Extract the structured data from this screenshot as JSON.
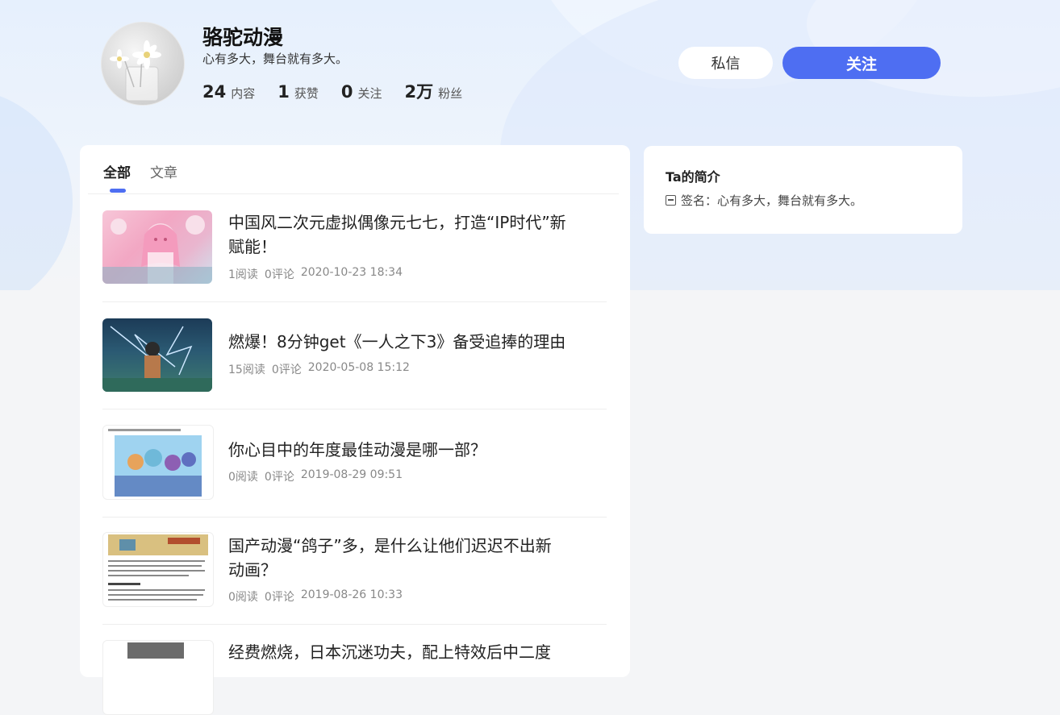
{
  "profile": {
    "name": "骆驼动漫",
    "bio": "心有多大，舞台就有多大。",
    "stats": [
      {
        "num": "24",
        "label": "内容"
      },
      {
        "num": "1",
        "label": "获赞"
      },
      {
        "num": "0",
        "label": "关注"
      },
      {
        "num": "2万",
        "label": "粉丝"
      }
    ]
  },
  "actions": {
    "message": "私信",
    "follow": "关注"
  },
  "tabs": [
    {
      "label": "全部"
    },
    {
      "label": "文章"
    }
  ],
  "articles": [
    {
      "title": "中国风二次元虚拟偶像元七七，打造“IP时代”新赋能！",
      "reads": "1阅读",
      "comments": "0评论",
      "time": "2020-10-23 18:34"
    },
    {
      "title": "燃爆！8分钟get《一人之下3》备受追捧的理由",
      "reads": "15阅读",
      "comments": "0评论",
      "time": "2020-05-08 15:12"
    },
    {
      "title": "你心目中的年度最佳动漫是哪一部？",
      "reads": "0阅读",
      "comments": "0评论",
      "time": "2019-08-29 09:51"
    },
    {
      "title": "国产动漫“鸽子”多，是什么让他们迟迟不出新动画？",
      "reads": "0阅读",
      "comments": "0评论",
      "time": "2019-08-26 10:33"
    },
    {
      "title": "经费燃烧，日本沉迷功夫，配上特效后中二度",
      "reads": "",
      "comments": "",
      "time": ""
    }
  ],
  "sidebar": {
    "title": "Ta的简介",
    "signature": "签名：心有多大，舞台就有多大。"
  },
  "colors": {
    "accent": "#4e6ef2"
  }
}
